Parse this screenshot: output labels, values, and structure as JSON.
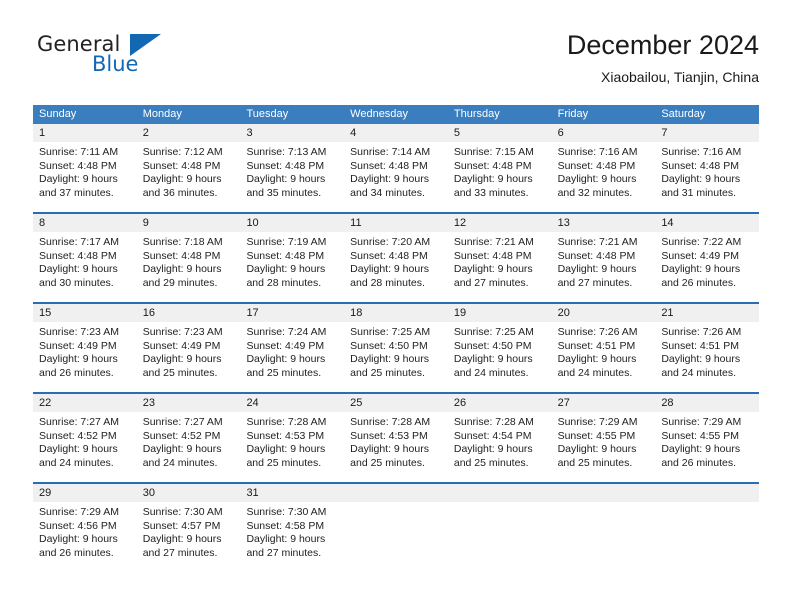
{
  "logo": {
    "word1": "General",
    "word2": "Blue",
    "triangle_color": "#1268b3"
  },
  "header": {
    "title": "December 2024",
    "subtitle": "Xiaobailou, Tianjin, China"
  },
  "theme": {
    "header_blue": "#3a7ebf",
    "separator_blue": "#2a6db2",
    "daynum_gray": "#f0f0f0"
  },
  "weekdays": [
    "Sunday",
    "Monday",
    "Tuesday",
    "Wednesday",
    "Thursday",
    "Friday",
    "Saturday"
  ],
  "weeks": [
    {
      "days": [
        {
          "num": "1",
          "l1": "Sunrise: 7:11 AM",
          "l2": "Sunset: 4:48 PM",
          "l3": "Daylight: 9 hours",
          "l4": "and 37 minutes."
        },
        {
          "num": "2",
          "l1": "Sunrise: 7:12 AM",
          "l2": "Sunset: 4:48 PM",
          "l3": "Daylight: 9 hours",
          "l4": "and 36 minutes."
        },
        {
          "num": "3",
          "l1": "Sunrise: 7:13 AM",
          "l2": "Sunset: 4:48 PM",
          "l3": "Daylight: 9 hours",
          "l4": "and 35 minutes."
        },
        {
          "num": "4",
          "l1": "Sunrise: 7:14 AM",
          "l2": "Sunset: 4:48 PM",
          "l3": "Daylight: 9 hours",
          "l4": "and 34 minutes."
        },
        {
          "num": "5",
          "l1": "Sunrise: 7:15 AM",
          "l2": "Sunset: 4:48 PM",
          "l3": "Daylight: 9 hours",
          "l4": "and 33 minutes."
        },
        {
          "num": "6",
          "l1": "Sunrise: 7:16 AM",
          "l2": "Sunset: 4:48 PM",
          "l3": "Daylight: 9 hours",
          "l4": "and 32 minutes."
        },
        {
          "num": "7",
          "l1": "Sunrise: 7:16 AM",
          "l2": "Sunset: 4:48 PM",
          "l3": "Daylight: 9 hours",
          "l4": "and 31 minutes."
        }
      ]
    },
    {
      "days": [
        {
          "num": "8",
          "l1": "Sunrise: 7:17 AM",
          "l2": "Sunset: 4:48 PM",
          "l3": "Daylight: 9 hours",
          "l4": "and 30 minutes."
        },
        {
          "num": "9",
          "l1": "Sunrise: 7:18 AM",
          "l2": "Sunset: 4:48 PM",
          "l3": "Daylight: 9 hours",
          "l4": "and 29 minutes."
        },
        {
          "num": "10",
          "l1": "Sunrise: 7:19 AM",
          "l2": "Sunset: 4:48 PM",
          "l3": "Daylight: 9 hours",
          "l4": "and 28 minutes."
        },
        {
          "num": "11",
          "l1": "Sunrise: 7:20 AM",
          "l2": "Sunset: 4:48 PM",
          "l3": "Daylight: 9 hours",
          "l4": "and 28 minutes."
        },
        {
          "num": "12",
          "l1": "Sunrise: 7:21 AM",
          "l2": "Sunset: 4:48 PM",
          "l3": "Daylight: 9 hours",
          "l4": "and 27 minutes."
        },
        {
          "num": "13",
          "l1": "Sunrise: 7:21 AM",
          "l2": "Sunset: 4:48 PM",
          "l3": "Daylight: 9 hours",
          "l4": "and 27 minutes."
        },
        {
          "num": "14",
          "l1": "Sunrise: 7:22 AM",
          "l2": "Sunset: 4:49 PM",
          "l3": "Daylight: 9 hours",
          "l4": "and 26 minutes."
        }
      ]
    },
    {
      "days": [
        {
          "num": "15",
          "l1": "Sunrise: 7:23 AM",
          "l2": "Sunset: 4:49 PM",
          "l3": "Daylight: 9 hours",
          "l4": "and 26 minutes."
        },
        {
          "num": "16",
          "l1": "Sunrise: 7:23 AM",
          "l2": "Sunset: 4:49 PM",
          "l3": "Daylight: 9 hours",
          "l4": "and 25 minutes."
        },
        {
          "num": "17",
          "l1": "Sunrise: 7:24 AM",
          "l2": "Sunset: 4:49 PM",
          "l3": "Daylight: 9 hours",
          "l4": "and 25 minutes."
        },
        {
          "num": "18",
          "l1": "Sunrise: 7:25 AM",
          "l2": "Sunset: 4:50 PM",
          "l3": "Daylight: 9 hours",
          "l4": "and 25 minutes."
        },
        {
          "num": "19",
          "l1": "Sunrise: 7:25 AM",
          "l2": "Sunset: 4:50 PM",
          "l3": "Daylight: 9 hours",
          "l4": "and 24 minutes."
        },
        {
          "num": "20",
          "l1": "Sunrise: 7:26 AM",
          "l2": "Sunset: 4:51 PM",
          "l3": "Daylight: 9 hours",
          "l4": "and 24 minutes."
        },
        {
          "num": "21",
          "l1": "Sunrise: 7:26 AM",
          "l2": "Sunset: 4:51 PM",
          "l3": "Daylight: 9 hours",
          "l4": "and 24 minutes."
        }
      ]
    },
    {
      "days": [
        {
          "num": "22",
          "l1": "Sunrise: 7:27 AM",
          "l2": "Sunset: 4:52 PM",
          "l3": "Daylight: 9 hours",
          "l4": "and 24 minutes."
        },
        {
          "num": "23",
          "l1": "Sunrise: 7:27 AM",
          "l2": "Sunset: 4:52 PM",
          "l3": "Daylight: 9 hours",
          "l4": "and 24 minutes."
        },
        {
          "num": "24",
          "l1": "Sunrise: 7:28 AM",
          "l2": "Sunset: 4:53 PM",
          "l3": "Daylight: 9 hours",
          "l4": "and 25 minutes."
        },
        {
          "num": "25",
          "l1": "Sunrise: 7:28 AM",
          "l2": "Sunset: 4:53 PM",
          "l3": "Daylight: 9 hours",
          "l4": "and 25 minutes."
        },
        {
          "num": "26",
          "l1": "Sunrise: 7:28 AM",
          "l2": "Sunset: 4:54 PM",
          "l3": "Daylight: 9 hours",
          "l4": "and 25 minutes."
        },
        {
          "num": "27",
          "l1": "Sunrise: 7:29 AM",
          "l2": "Sunset: 4:55 PM",
          "l3": "Daylight: 9 hours",
          "l4": "and 25 minutes."
        },
        {
          "num": "28",
          "l1": "Sunrise: 7:29 AM",
          "l2": "Sunset: 4:55 PM",
          "l3": "Daylight: 9 hours",
          "l4": "and 26 minutes."
        }
      ]
    },
    {
      "days": [
        {
          "num": "29",
          "l1": "Sunrise: 7:29 AM",
          "l2": "Sunset: 4:56 PM",
          "l3": "Daylight: 9 hours",
          "l4": "and 26 minutes."
        },
        {
          "num": "30",
          "l1": "Sunrise: 7:30 AM",
          "l2": "Sunset: 4:57 PM",
          "l3": "Daylight: 9 hours",
          "l4": "and 27 minutes."
        },
        {
          "num": "31",
          "l1": "Sunrise: 7:30 AM",
          "l2": "Sunset: 4:58 PM",
          "l3": "Daylight: 9 hours",
          "l4": "and 27 minutes."
        },
        {
          "num": "",
          "l1": "",
          "l2": "",
          "l3": "",
          "l4": ""
        },
        {
          "num": "",
          "l1": "",
          "l2": "",
          "l3": "",
          "l4": ""
        },
        {
          "num": "",
          "l1": "",
          "l2": "",
          "l3": "",
          "l4": ""
        },
        {
          "num": "",
          "l1": "",
          "l2": "",
          "l3": "",
          "l4": ""
        }
      ]
    }
  ]
}
